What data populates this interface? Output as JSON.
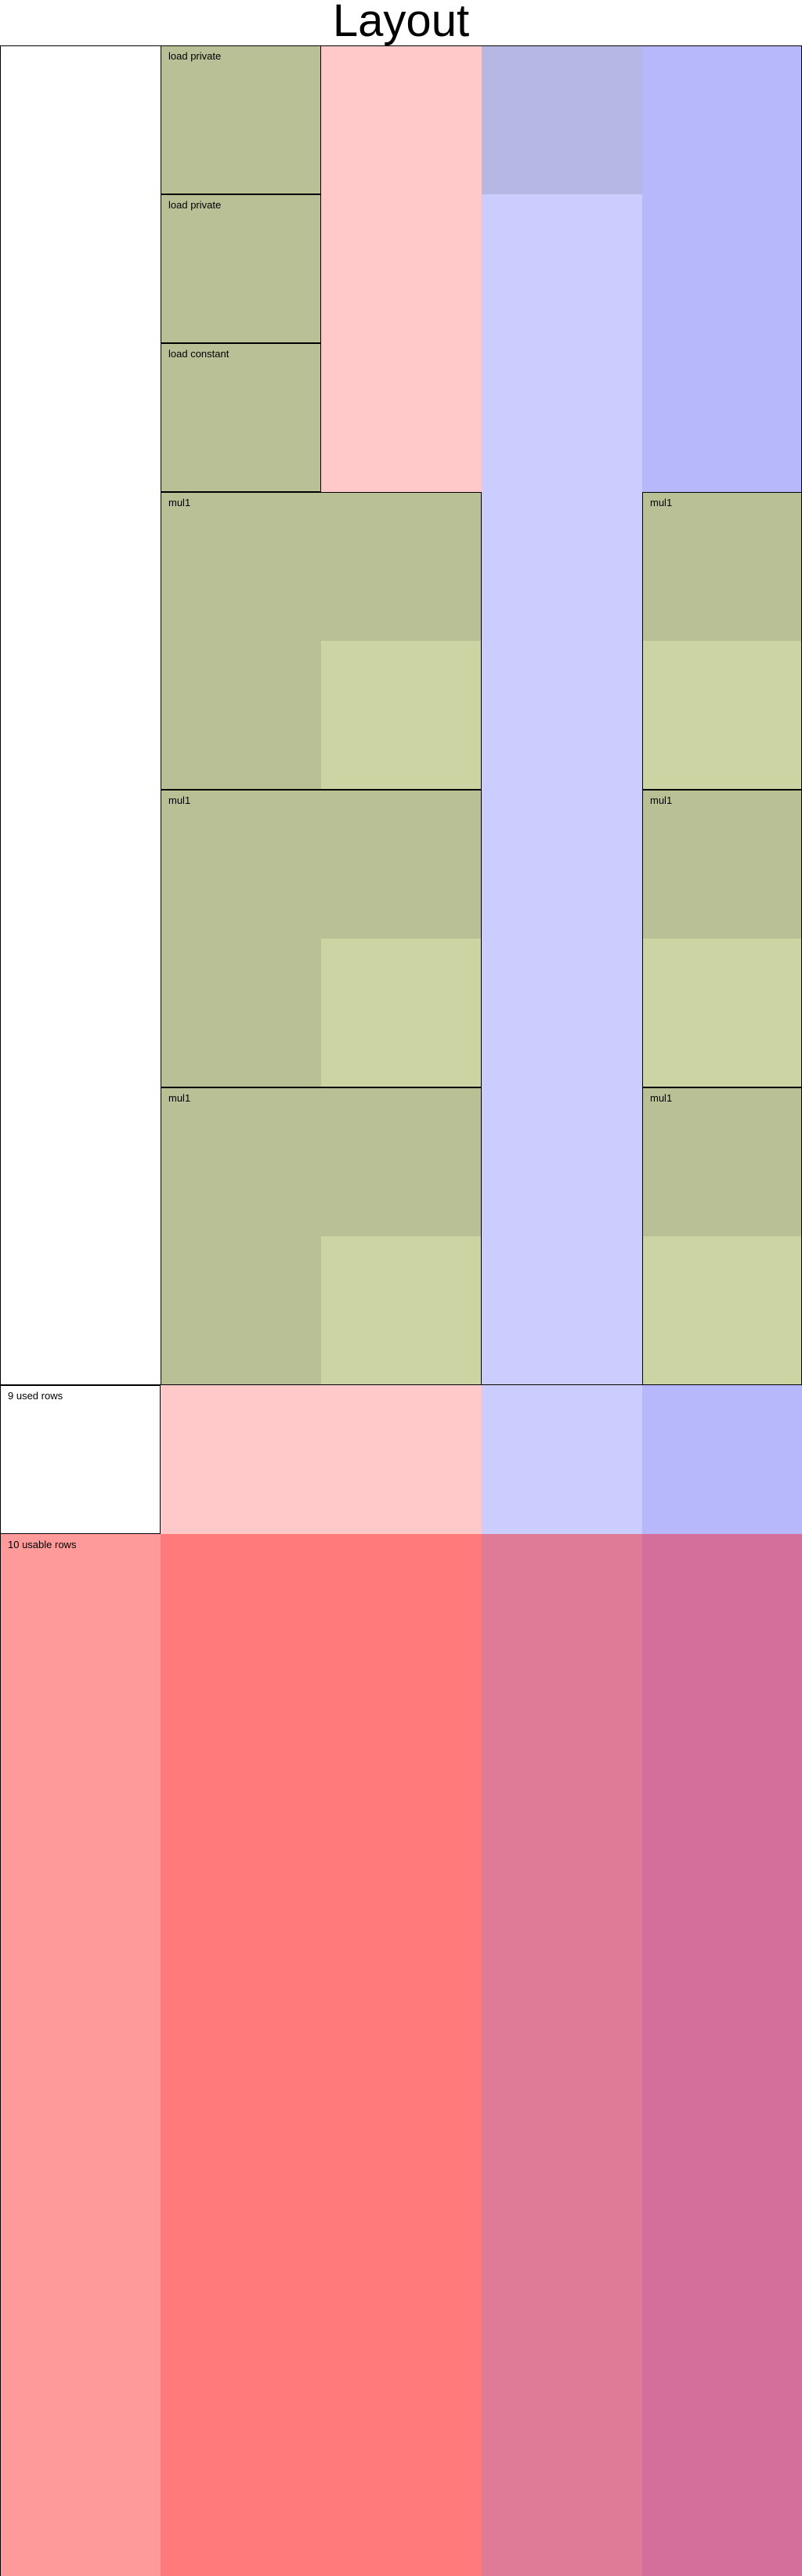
{
  "title": "Layout",
  "colors": {
    "region_pink": "#ffc9c9",
    "advice_blue_light": "#cccdff",
    "advice_blue_medium": "#b7b7fb",
    "advice_purple": "#b7b7e3",
    "gate_olive": "#b9c095",
    "gate_olive_light": "#cdd4a3",
    "unused_salmon": "#ff9a9a",
    "unused_red": "#ff7b7b",
    "unused_rose": "#df7b97",
    "unused_magenta": "#d36f9a",
    "border": "#000000"
  },
  "regions": [
    {
      "label": "load private"
    },
    {
      "label": "load private"
    },
    {
      "label": "load constant"
    },
    {
      "label": "mul1"
    },
    {
      "label": "mul1"
    },
    {
      "label": "mul1"
    },
    {
      "label": "mul1"
    },
    {
      "label": "mul1"
    },
    {
      "label": "mul1"
    }
  ],
  "rows": {
    "used_label": "9 used rows",
    "usable_label": "10 usable rows"
  }
}
